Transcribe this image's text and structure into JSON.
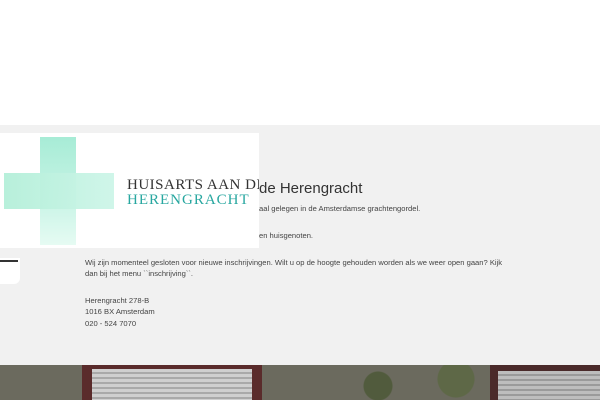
{
  "logo": {
    "line1": "HUISARTS AAN DE",
    "line2": "HERENGRACHT",
    "accent": "#28a7a0",
    "cross_color": "#b4efd9"
  },
  "main": {
    "heading_partial": "de Herengracht",
    "intro_partial": "aal gelegen in de Amsterdamse grachtengordel.",
    "second_partial": "en huisgenoten.",
    "notice_line1": "Wij zijn momenteel gesloten voor nieuwe inschrijvingen. Wilt u op de hoogte gehouden worden als we weer open gaan? Kijk",
    "notice_line2": "dan bij het menu ``inschrijving``.",
    "address_street": "Herengracht 278-B",
    "address_city": "1016 BX Amsterdam",
    "phone": "020 - 524 7070"
  },
  "colors": {
    "panel_bg": "#f1f1f1",
    "text": "#333333"
  }
}
